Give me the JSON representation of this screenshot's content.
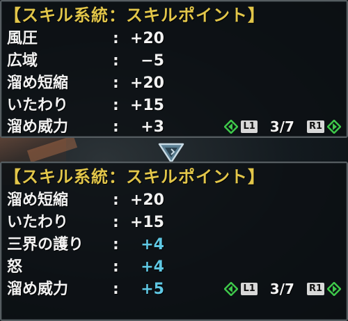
{
  "panels": [
    {
      "header": "【スキル系統：スキルポイント】",
      "rows": [
        {
          "skill": "風圧",
          "colon": ":",
          "value": "+20",
          "highlight": false
        },
        {
          "skill": "広域",
          "colon": ":",
          "value": "−5",
          "highlight": false
        },
        {
          "skill": "溜め短縮",
          "colon": ":",
          "value": "+20",
          "highlight": false
        },
        {
          "skill": "いたわり",
          "colon": ":",
          "value": "+15",
          "highlight": false
        },
        {
          "skill": "溜め威力",
          "colon": ":",
          "value": "+3",
          "highlight": false
        }
      ],
      "pager": {
        "left_button": "L1",
        "page": "3/7",
        "right_button": "R1"
      }
    },
    {
      "header": "【スキル系統：スキルポイント】",
      "rows": [
        {
          "skill": "溜め短縮",
          "colon": ":",
          "value": "+20",
          "highlight": false
        },
        {
          "skill": "いたわり",
          "colon": ":",
          "value": "+15",
          "highlight": false
        },
        {
          "skill": "三界の護り",
          "colon": ":",
          "value": "+4",
          "highlight": true
        },
        {
          "skill": "怒",
          "colon": ":",
          "value": "+4",
          "highlight": true
        },
        {
          "skill": "溜め威力",
          "colon": ":",
          "value": "+5",
          "highlight": true
        }
      ],
      "pager": {
        "left_button": "L1",
        "page": "3/7",
        "right_button": "R1"
      }
    }
  ],
  "icons": {
    "transition": "down-triangle-icon",
    "page_prev": "diamond-left-arrow-icon",
    "page_next": "diamond-right-arrow-icon"
  },
  "colors": {
    "header": "#e2c64a",
    "text": "#f2f2f2",
    "highlight_value": "#5fc8e4",
    "arrow_green": "#3ec84a",
    "indicator": "#8fb4c8"
  }
}
